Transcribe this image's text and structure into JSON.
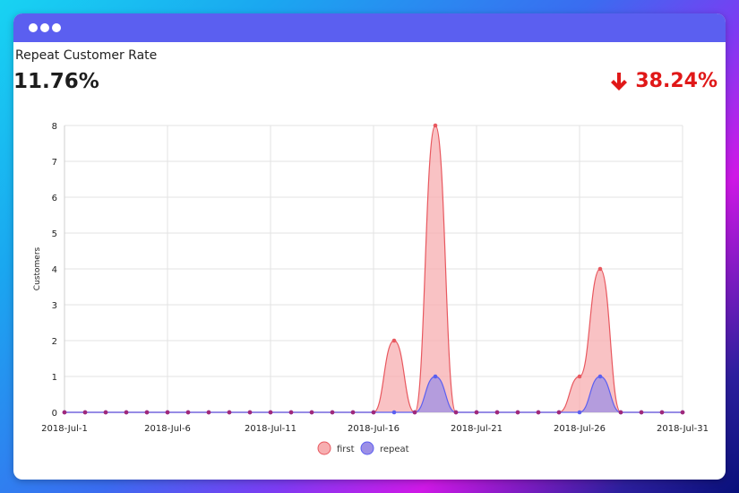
{
  "window": {
    "dots": 3
  },
  "card": {
    "title": "Repeat Customer Rate",
    "value": "11.76%",
    "delta": "38.24%",
    "delta_icon": "arrow-down-icon"
  },
  "colors": {
    "titlebar": "#5b5ff0",
    "first_line": "#e8585f",
    "first_fill": "#f7aeb0",
    "repeat_line": "#5b5ff0",
    "repeat_fill": "#9c8fe6",
    "delta": "#e01818"
  },
  "chart_data": {
    "type": "area",
    "ylabel": "Customers",
    "ylim": [
      0,
      8
    ],
    "yticks": [
      0,
      1,
      2,
      3,
      4,
      5,
      6,
      7,
      8
    ],
    "x": [
      "2018-Jul-1",
      "2018-Jul-2",
      "2018-Jul-3",
      "2018-Jul-4",
      "2018-Jul-5",
      "2018-Jul-6",
      "2018-Jul-7",
      "2018-Jul-8",
      "2018-Jul-9",
      "2018-Jul-10",
      "2018-Jul-11",
      "2018-Jul-12",
      "2018-Jul-13",
      "2018-Jul-14",
      "2018-Jul-15",
      "2018-Jul-16",
      "2018-Jul-17",
      "2018-Jul-18",
      "2018-Jul-19",
      "2018-Jul-20",
      "2018-Jul-21",
      "2018-Jul-22",
      "2018-Jul-23",
      "2018-Jul-24",
      "2018-Jul-25",
      "2018-Jul-26",
      "2018-Jul-27",
      "2018-Jul-28",
      "2018-Jul-29",
      "2018-Jul-30",
      "2018-Jul-31"
    ],
    "xtick_labels": [
      "2018-Jul-1",
      "2018-Jul-6",
      "2018-Jul-11",
      "2018-Jul-16",
      "2018-Jul-21",
      "2018-Jul-26",
      "2018-Jul-31"
    ],
    "grid": true,
    "legend_position": "bottom",
    "series": [
      {
        "name": "first",
        "values": [
          0,
          0,
          0,
          0,
          0,
          0,
          0,
          0,
          0,
          0,
          0,
          0,
          0,
          0,
          0,
          0,
          2,
          0,
          8,
          0,
          0,
          0,
          0,
          0,
          0,
          1,
          4,
          0,
          0,
          0,
          0
        ]
      },
      {
        "name": "repeat",
        "values": [
          0,
          0,
          0,
          0,
          0,
          0,
          0,
          0,
          0,
          0,
          0,
          0,
          0,
          0,
          0,
          0,
          0,
          0,
          1,
          0,
          0,
          0,
          0,
          0,
          0,
          0,
          1,
          0,
          0,
          0,
          0
        ]
      }
    ]
  }
}
